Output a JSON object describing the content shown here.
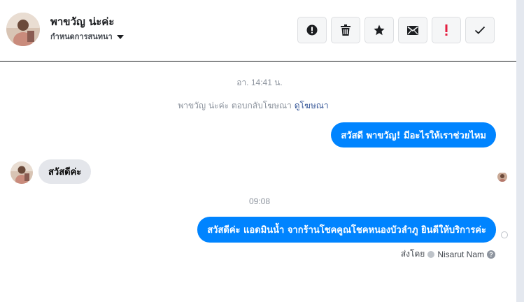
{
  "header": {
    "title": "พาขวัญ น่ะค่ะ",
    "subtitle": "กำหนดการสนทนา",
    "toolbar": [
      {
        "icon": "alert-circle-icon",
        "label": "alert"
      },
      {
        "icon": "trash-icon",
        "label": "delete"
      },
      {
        "icon": "star-icon",
        "label": "star"
      },
      {
        "icon": "envelope-icon",
        "label": "mark-unread"
      },
      {
        "icon": "exclamation-icon",
        "label": "spam"
      },
      {
        "icon": "check-icon",
        "label": "done"
      }
    ]
  },
  "conversation": {
    "timestamp_1": "อา. 14:41 น.",
    "notice_text": "พาขวัญ น่ะค่ะ ตอบกลับโฆษณา",
    "notice_link": "ดูโฆษณา",
    "msg_out_1": "สวัสดี พาขวัญ! มีอะไรให้เราช่วยไหม",
    "msg_in_1": "สวัสดีค่ะ",
    "timestamp_2": "09:08",
    "msg_out_2": "สวัสดีค่ะ แอดมินน้ำ จากร้านโชคคูณโชคหนองบัวลำภู ยินดีให้บริการค่ะ",
    "sent_by_label": "ส่งโดย",
    "sent_by_name": "Nisarut Nam",
    "help_mark": "?"
  },
  "colors": {
    "accent": "#0084ff",
    "incoming_bubble": "#e4e6eb",
    "spam_red": "#e41e3f",
    "meta_gray": "#8d949e"
  }
}
